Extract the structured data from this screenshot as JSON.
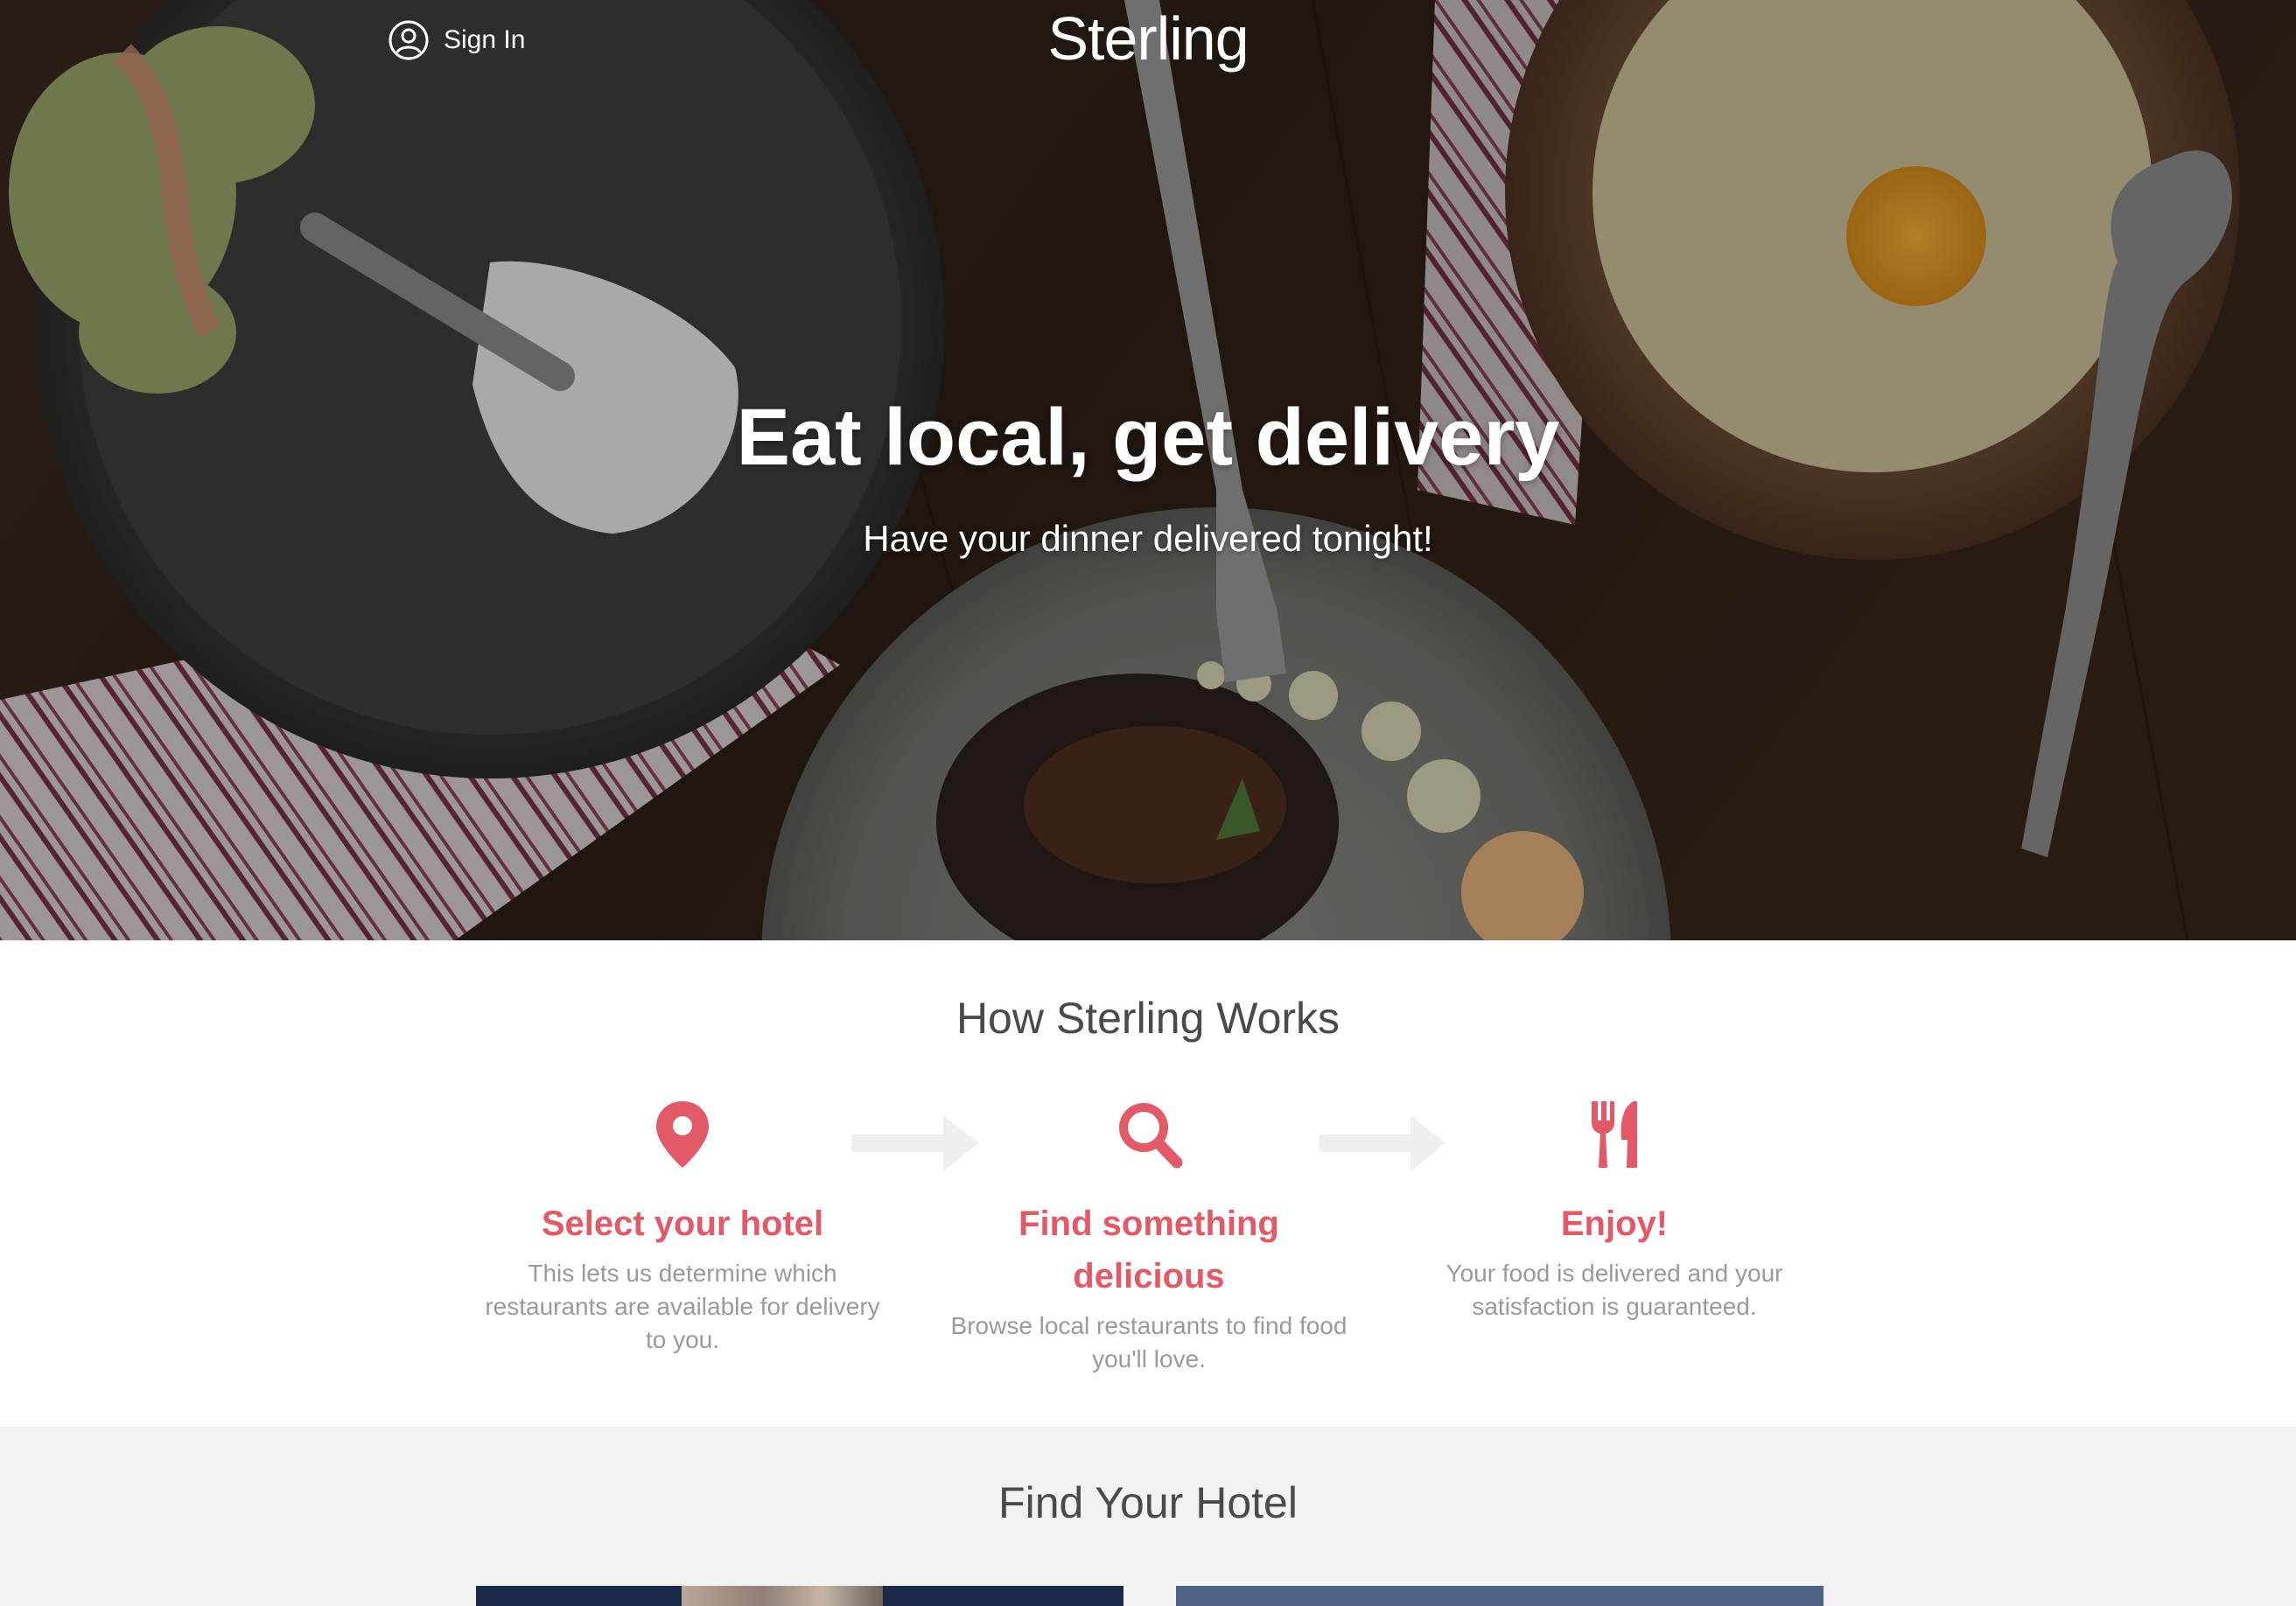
{
  "header": {
    "signin_label": "Sign In",
    "brand": "Sterling"
  },
  "hero": {
    "title": "Eat local, get delivery",
    "subtitle": "Have your dinner delivered tonight!"
  },
  "how_it_works": {
    "title": "How Sterling Works",
    "steps": [
      {
        "icon": "map-pin-icon",
        "title": "Select your hotel",
        "description": "This lets us determine which restaurants are available for delivery to you."
      },
      {
        "icon": "magnifier-icon",
        "title": "Find something delicious",
        "description": "Browse local restaurants to find food you'll love."
      },
      {
        "icon": "fork-knife-icon",
        "title": "Enjoy!",
        "description": "Your food is delivered and your satisfaction is guaranteed."
      }
    ]
  },
  "find_hotel": {
    "title": "Find Your Hotel"
  },
  "colors": {
    "accent": "#e25a68",
    "text_dark": "#4a4a4a",
    "text_muted": "#9a9a9a",
    "section_bg": "#f2f2f2",
    "arrow": "#efefef"
  }
}
